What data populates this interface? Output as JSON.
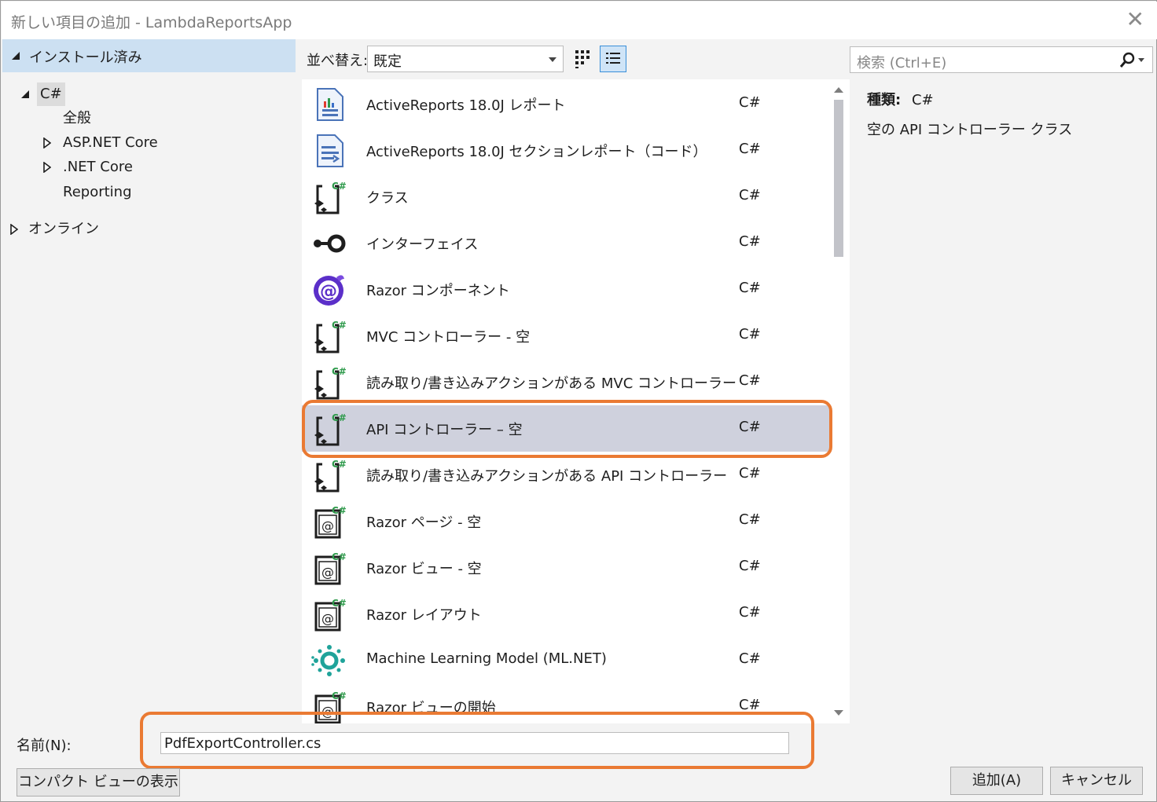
{
  "window": {
    "title": "新しい項目の追加 - LambdaReportsApp",
    "close": "✕"
  },
  "tree": {
    "installed": "インストール済み",
    "csharp": "C#",
    "children": [
      "全般",
      "ASP.NET Core",
      ".NET Core",
      "Reporting"
    ],
    "online": "オンライン"
  },
  "toolbar": {
    "sort_label": "並べ替え:",
    "sort_value": "既定",
    "search_placeholder": "検索 (Ctrl+E)"
  },
  "items": [
    {
      "name": "ActiveReports 18.0J レポート",
      "lang": "C#",
      "icon": "report-icon"
    },
    {
      "name": "ActiveReports 18.0J セクションレポート（コード）",
      "lang": "C#",
      "icon": "section-report-icon"
    },
    {
      "name": "クラス",
      "lang": "C#",
      "icon": "class-icon"
    },
    {
      "name": "インターフェイス",
      "lang": "C#",
      "icon": "interface-icon"
    },
    {
      "name": "Razor コンポーネント",
      "lang": "C#",
      "icon": "razor-component-icon"
    },
    {
      "name": "MVC コントローラー - 空",
      "lang": "C#",
      "icon": "controller-icon"
    },
    {
      "name": "読み取り/書き込みアクションがある MVC コントローラー",
      "lang": "C#",
      "icon": "controller-icon"
    },
    {
      "name": "API コントローラー – 空",
      "lang": "C#",
      "icon": "controller-icon"
    },
    {
      "name": "読み取り/書き込みアクションがある API コントローラー",
      "lang": "C#",
      "icon": "controller-icon"
    },
    {
      "name": "Razor ページ - 空",
      "lang": "C#",
      "icon": "razor-page-icon"
    },
    {
      "name": "Razor ビュー - 空",
      "lang": "C#",
      "icon": "razor-page-icon"
    },
    {
      "name": "Razor レイアウト",
      "lang": "C#",
      "icon": "razor-page-icon"
    },
    {
      "name": "Machine Learning Model (ML.NET)",
      "lang": "C#",
      "icon": "ml-model-icon"
    },
    {
      "name": "Razor ビューの開始",
      "lang": "C#",
      "icon": "razor-page-icon"
    }
  ],
  "selected_index": 7,
  "details": {
    "kind_label": "種類:",
    "kind_value": "C#",
    "description": "空の API コントローラー クラス"
  },
  "bottom": {
    "name_label": "名前(N):",
    "name_value": "PdfExportController.cs",
    "compact_button": "コンパクト ビューの表示(C)",
    "add_button": "追加(A)",
    "cancel_button": "キャンセル"
  },
  "colors": {
    "highlight": "#ea7a33",
    "selection": "#cfd1dd",
    "installed_bg": "#cce0f2"
  }
}
